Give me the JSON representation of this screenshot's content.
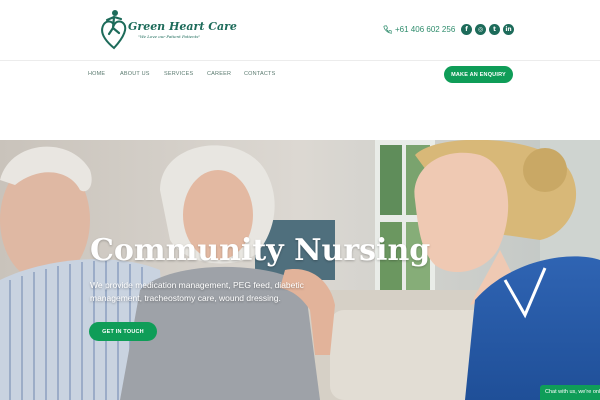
{
  "brand": {
    "name": "Green Heart Care",
    "tagline": "\"We Love our Patient Patients\""
  },
  "contact": {
    "phone": "+61 406 602 256"
  },
  "socials": [
    {
      "icon": "facebook-icon",
      "glyph": "f"
    },
    {
      "icon": "instagram-icon",
      "glyph": "◎"
    },
    {
      "icon": "twitter-icon",
      "glyph": "t"
    },
    {
      "icon": "linkedin-icon",
      "glyph": "in"
    }
  ],
  "nav": {
    "home": "HOME",
    "about": "ABOUT US",
    "services": "SERVICES",
    "career": "CAREER",
    "contacts": "CONTACTS"
  },
  "enquiry_button": "MAKE AN ENQUIRY",
  "hero": {
    "title": "Community Nursing",
    "subtitle": "We provide medication management, PEG feed, diabetic management, tracheostomy care, wound dressing.",
    "cta": "GET IN TOUCH"
  },
  "chat": {
    "label": "Chat with us, we're online"
  },
  "colors": {
    "brand_green": "#0f9d58",
    "logo_green": "#1d6b5a"
  }
}
